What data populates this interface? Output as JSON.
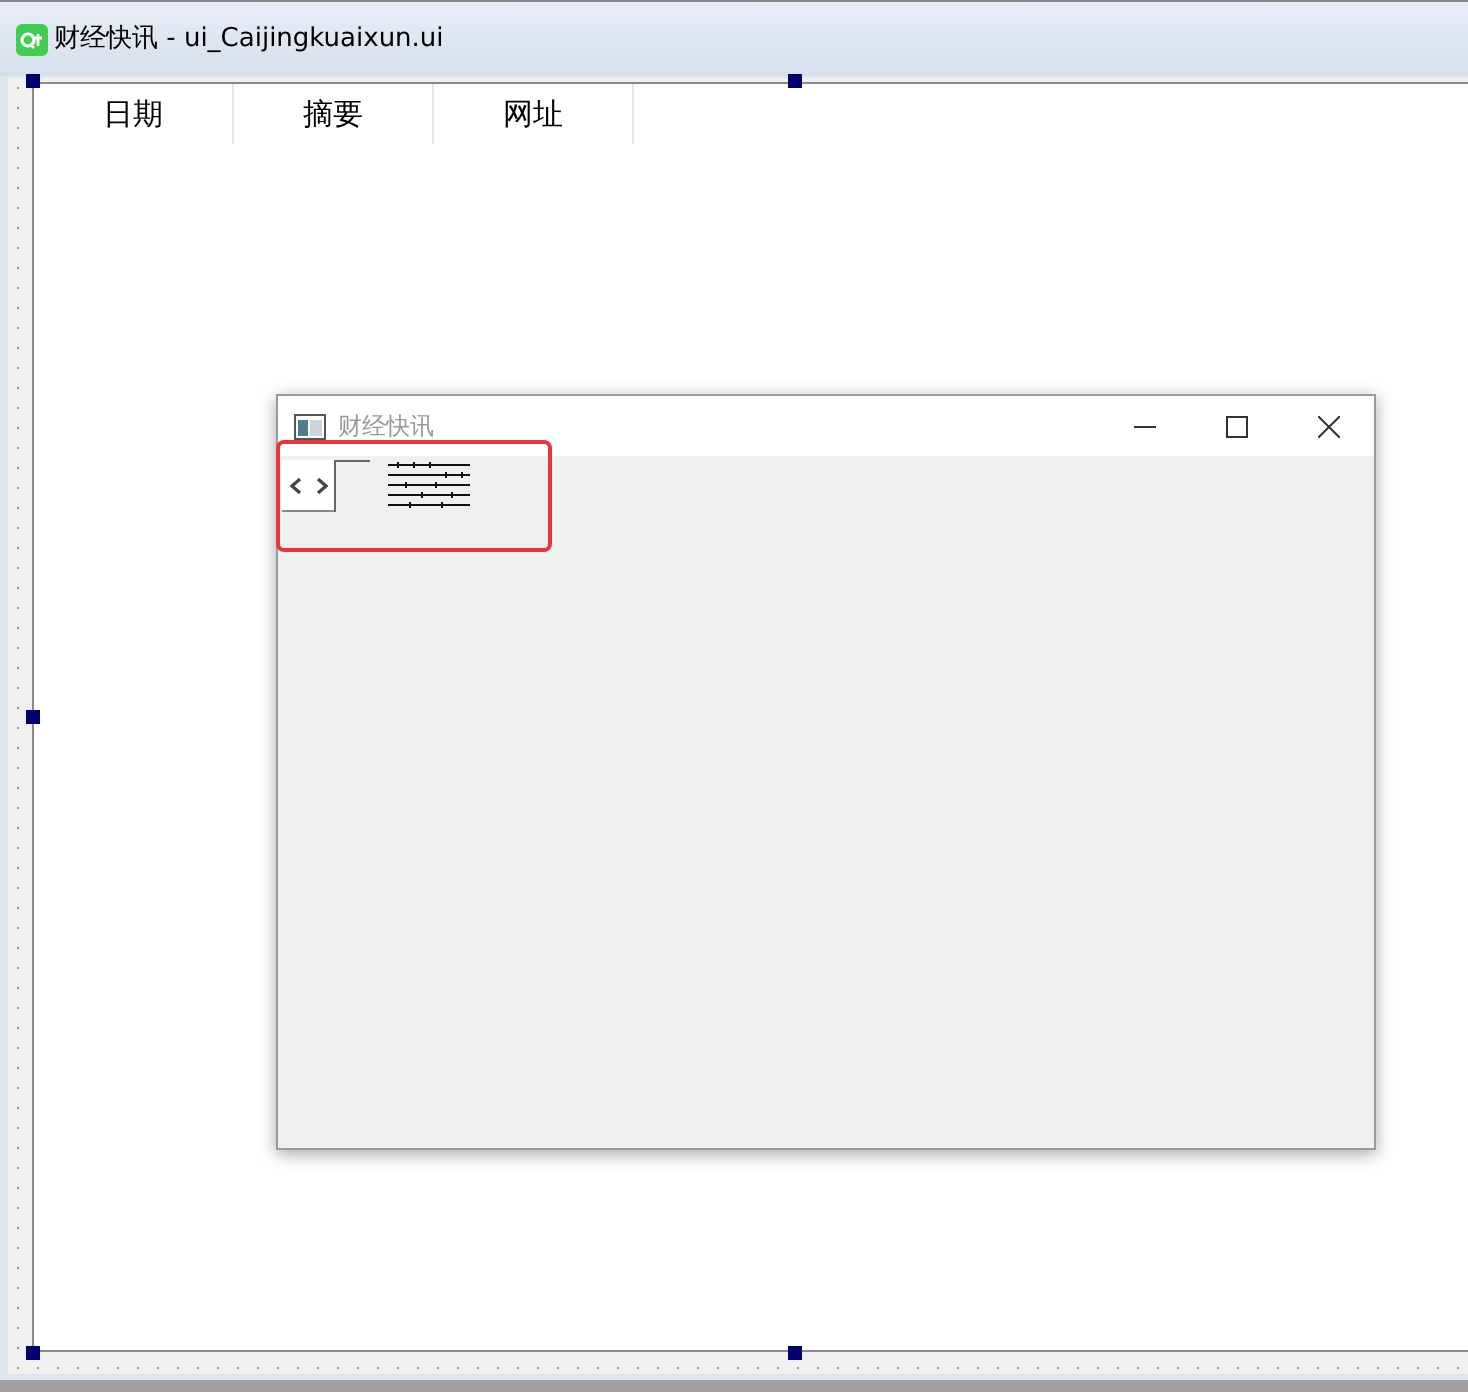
{
  "window": {
    "title": "财经快讯 - ui_Caijingkuaixun.ui"
  },
  "table": {
    "columns": [
      "日期",
      "摘要",
      "网址"
    ]
  },
  "preview_window": {
    "title": "财经快讯"
  }
}
